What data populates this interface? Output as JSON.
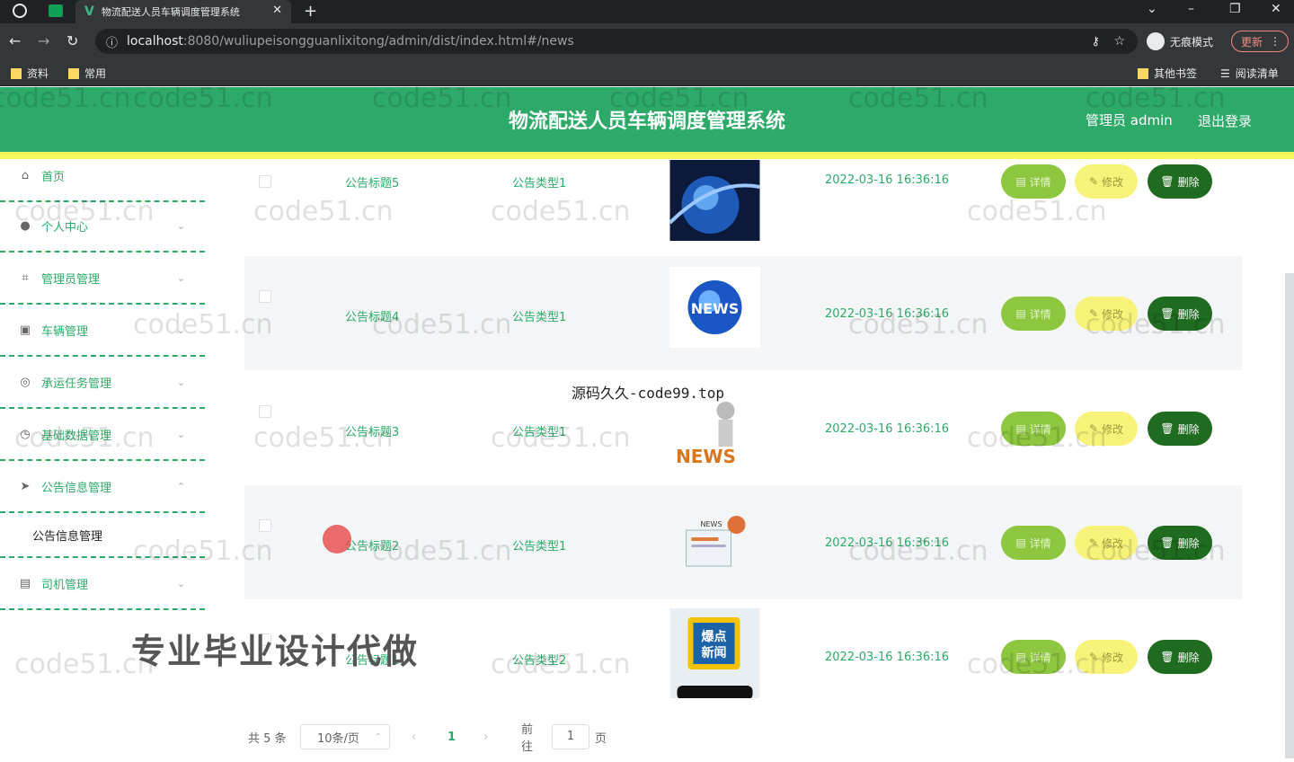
{
  "browser": {
    "tab_title": "物流配送人员车辆调度管理系统",
    "url_host": "localhost",
    "url_path": ":8080/wuliupeisongguanlixitong/admin/dist/index.html#/news",
    "incognito_label": "无痕模式",
    "update_label": "更新",
    "bookmarks": [
      "资料",
      "常用",
      "其他书签",
      "阅读清单"
    ]
  },
  "header": {
    "title": "物流配送人员车辆调度管理系统",
    "admin_label": "管理员 admin",
    "logout_label": "退出登录"
  },
  "sidebar": {
    "items": [
      {
        "label": "首页",
        "icon": "home-icon"
      },
      {
        "label": "个人中心",
        "icon": "user-icon"
      },
      {
        "label": "管理员管理",
        "icon": "crop-icon"
      },
      {
        "label": "车辆管理",
        "icon": "car-icon"
      },
      {
        "label": "承运任务管理",
        "icon": "target-icon"
      },
      {
        "label": "基础数据管理",
        "icon": "compass-icon"
      },
      {
        "label": "公告信息管理",
        "icon": "send-icon"
      },
      {
        "label": "司机管理",
        "icon": "document-icon"
      }
    ],
    "sub_item": "公告信息管理"
  },
  "table": {
    "rows": [
      {
        "title": "公告标题5",
        "type": "公告类型1",
        "time": "2022-03-16 16:36:16"
      },
      {
        "title": "公告标题4",
        "type": "公告类型1",
        "time": "2022-03-16 16:36:16"
      },
      {
        "title": "公告标题3",
        "type": "公告类型1",
        "time": "2022-03-16 16:36:16"
      },
      {
        "title": "公告标题2",
        "type": "公告类型1",
        "time": "2022-03-16 16:36:16"
      },
      {
        "title": "公告标题1",
        "type": "公告类型2",
        "time": "2022-03-16 16:36:16"
      }
    ],
    "btn_detail": "详情",
    "btn_edit": "修改",
    "btn_delete": "删除"
  },
  "pagination": {
    "total": "共 5 条",
    "page_size": "10条/页",
    "current_page": "1",
    "goto_label": "前往",
    "goto_value": "1",
    "page_suffix": "页"
  },
  "overlays": {
    "watermark": "code51.cn",
    "banner": "专业毕业设计代做",
    "source_note": "源码久久-code99.top"
  },
  "colors": {
    "primary": "#2daa68",
    "accent_yellow": "#f5f55c",
    "detail_btn": "#8dc63f",
    "edit_btn": "#f7f37a",
    "delete_btn": "#1f6b1f"
  }
}
